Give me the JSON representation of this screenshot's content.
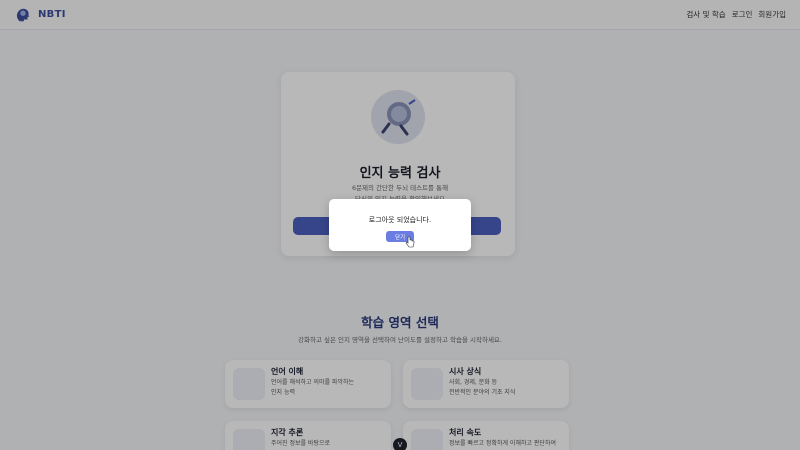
{
  "header": {
    "logo_text": "NBTI",
    "nav": [
      "검사 및 학습",
      "로그인",
      "회원가입"
    ]
  },
  "hero": {
    "title": "인지 능력 검사",
    "desc_line1": "6문제의 간단한 두뇌 테스트를 통해",
    "desc_line2": "당신의 인지 능력을 확인해보세요"
  },
  "section": {
    "title": "학습 영역 선택",
    "subtitle": "강화하고 싶은 인지 영역을 선택하여 난이도를 설정하고 학습을 시작하세요."
  },
  "areas": [
    {
      "name": "언어 이해",
      "desc": "언어를 해석하고 의미를 파악하는\n인지 능력",
      "icon": "presentation-icon"
    },
    {
      "name": "시사 상식",
      "desc": "사회, 경제, 문화 등\n전반적인 분야의 기초 지식",
      "icon": "reading-icon"
    },
    {
      "name": "지각 추론",
      "desc": "주어진 정보를 바탕으로",
      "icon": "thinking-icon"
    },
    {
      "name": "처리 속도",
      "desc": "정보를 빠르고 정확하게 이해하고 판단하여",
      "icon": "speed-icon"
    }
  ],
  "modal": {
    "message": "로그아웃 되었습니다.",
    "close_label": "닫기"
  },
  "fab_label": "V",
  "colors": {
    "accent": "#4b5fbf",
    "modal_button": "#6b7de0",
    "title_blue": "#2a3a7a"
  }
}
